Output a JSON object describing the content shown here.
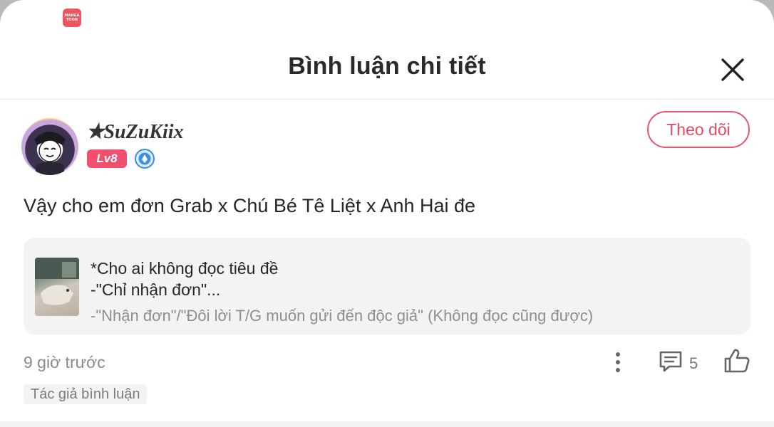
{
  "app": {
    "logo_line1": "MANGA",
    "logo_line2": "TOON"
  },
  "header": {
    "title": "Bình luận chi tiết",
    "close_icon": "close-icon"
  },
  "user": {
    "name": "✭SuZuKiix",
    "level": "Lv8",
    "verify_icon": "verified-badge-icon",
    "follow_label": "Theo dõi"
  },
  "comment": {
    "text": "Vậy cho em đơn Grab x Chú Bé Tê Liệt x Anh Hai đe"
  },
  "quote": {
    "line1": "*Cho ai không đọc tiêu đề",
    "line2": "-\"Chỉ nhận đơn\"...",
    "line3": "-\"Nhận đơn\"/\"Đôi lời T/G muốn gửi đến độc giả\" (Không đọc cũng được)"
  },
  "meta": {
    "time": "9 giờ trước",
    "more_icon": "more-vertical-icon",
    "comment_icon": "comment-icon",
    "comment_count": "5",
    "like_icon": "thumbs-up-icon"
  },
  "author_tag": "Tác giả bình luận",
  "colors": {
    "accent": "#e8566e",
    "badge": "#f0506e",
    "verify": "#3d8fe0"
  }
}
